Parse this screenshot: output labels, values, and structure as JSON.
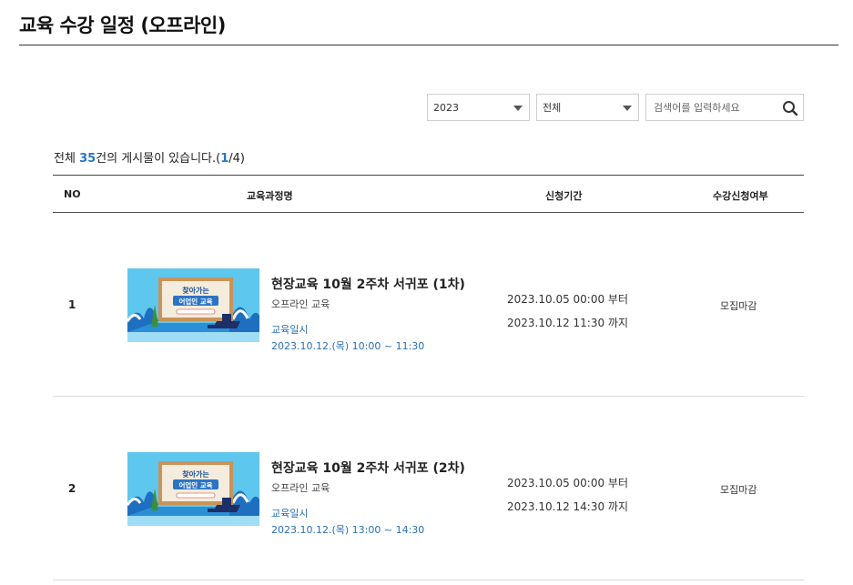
{
  "page": {
    "title": "교육 수강 일정 (오프라인)"
  },
  "filters": {
    "year": "2023",
    "category": "전체",
    "search_placeholder": "검색어를 입력하세요"
  },
  "summary": {
    "prefix": "전체 ",
    "count": "35",
    "middle": "건의 게시물이 있습니다.(",
    "page_current": "1",
    "page_total": "/4)"
  },
  "table": {
    "headers": {
      "no": "NO",
      "course": "교육과정명",
      "period": "신청기간",
      "status": "수강신청여부"
    },
    "rows": [
      {
        "no": "1",
        "title": "현장교육 10월 2주차 서귀포 (1차)",
        "type": "오프라인 교육",
        "date_label": "교육일시",
        "date_value": "2023.10.12.(목) 10:00 ~ 11:30",
        "period_start": "2023.10.05 00:00 부터",
        "period_end": "2023.10.12 11:30 까지",
        "status": "모집마감",
        "thumb_line1": "찾아가는",
        "thumb_line2": "어업인 교육"
      },
      {
        "no": "2",
        "title": "현장교육 10월 2주차 서귀포 (2차)",
        "type": "오프라인 교육",
        "date_label": "교육일시",
        "date_value": "2023.10.12.(목) 13:00 ~ 14:30",
        "period_start": "2023.10.05 00:00 부터",
        "period_end": "2023.10.12 14:30 까지",
        "status": "모집마감",
        "thumb_line1": "찾아가는",
        "thumb_line2": "어업인 교육"
      }
    ]
  },
  "colors": {
    "accent": "#2a74c5",
    "thumb_sky": "#5ec7ee",
    "thumb_board": "#c9935a"
  }
}
